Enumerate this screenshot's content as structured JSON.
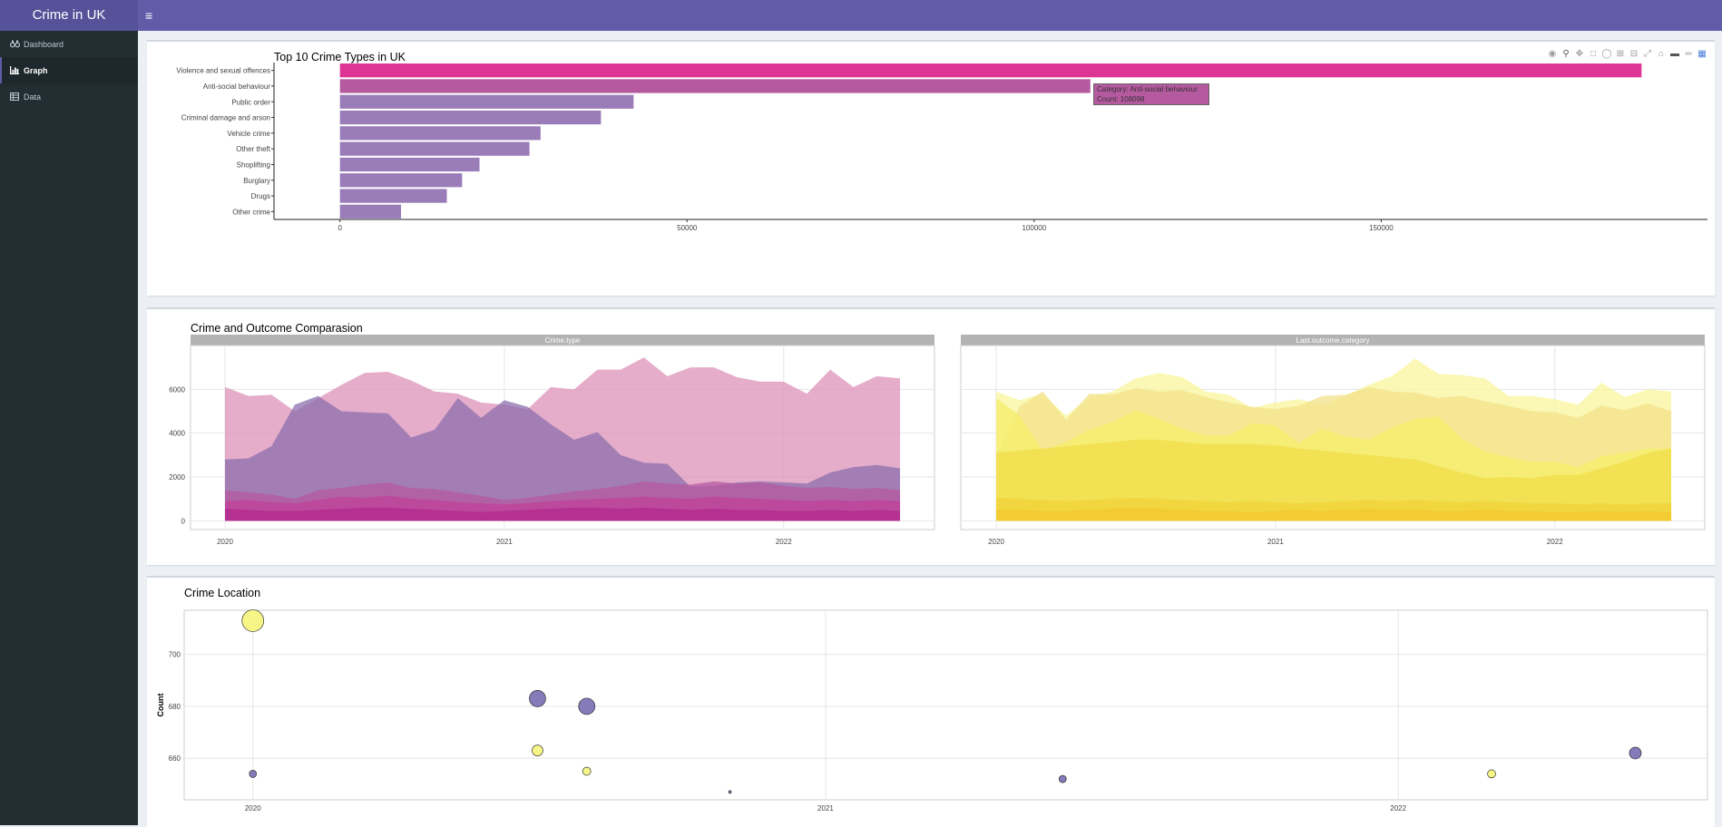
{
  "app": {
    "title": "Crime in UK"
  },
  "sidebar": {
    "items": [
      {
        "label": "Dashboard",
        "icon": "binoculars-icon"
      },
      {
        "label": "Graph",
        "icon": "bar-chart-icon",
        "active": true
      },
      {
        "label": "Data",
        "icon": "table-icon"
      }
    ]
  },
  "panels": {
    "top10_title": "Top 10 Crime Types in UK",
    "comparison_title": "Crime and Outcome Comparasion",
    "location_title": "Crime Location",
    "facet_left": "Crime.type",
    "facet_right": "Last.outcome.category"
  },
  "tooltip": {
    "line1": "Category: Anti-social behaviour",
    "line2": "Count: 108098"
  },
  "colors": {
    "sidebar": "#222d32",
    "topbar": "#605ca8",
    "logo": "#555299",
    "top_bar": "#de3493",
    "bar": "#9a7cb9"
  },
  "chart_data": [
    {
      "type": "bar",
      "orientation": "horizontal",
      "title": "Top 10 Crime Types in UK",
      "categories": [
        "Violence and sexual offences",
        "Anti-social behaviour",
        "Public order",
        "Criminal damage and arson",
        "Vehicle crime",
        "Other theft",
        "Shoplifting",
        "Burglary",
        "Drugs",
        "Other crime"
      ],
      "values": [
        187500,
        108098,
        42300,
        37600,
        28900,
        27300,
        20100,
        17600,
        15400,
        8800
      ],
      "xticks": [
        0,
        50000,
        100000,
        150000
      ],
      "xlim": [
        -9500,
        197000
      ]
    },
    {
      "type": "area",
      "title": "Crime and Outcome Comparasion",
      "facets": [
        "Crime.type",
        "Last.outcome.category"
      ],
      "x_ticks": [
        "2020",
        "2021",
        "2022"
      ],
      "y_ticks": [
        0,
        2000,
        4000,
        6000
      ],
      "ylim": [
        -400,
        8000
      ],
      "months": 30,
      "left_series": [
        {
          "color": "#dc91b8",
          "values": [
            6100,
            5700,
            5750,
            5000,
            5600,
            6200,
            6750,
            6800,
            6400,
            5900,
            5800,
            5400,
            5300,
            5100,
            6100,
            6000,
            6900,
            6900,
            7450,
            6600,
            7000,
            7000,
            6550,
            6350,
            6350,
            5800,
            6900,
            6100,
            6600,
            6500
          ]
        },
        {
          "color": "#8c6fae",
          "values": [
            2800,
            2850,
            3400,
            5300,
            5700,
            5000,
            4950,
            4900,
            3800,
            4150,
            5600,
            4700,
            5500,
            5200,
            4400,
            3700,
            4050,
            3000,
            2650,
            2600,
            1550,
            1600,
            1750,
            1800,
            1750,
            1700,
            2200,
            2450,
            2550,
            2400
          ]
        },
        {
          "color": "#b65aa0",
          "values": [
            1400,
            1300,
            1200,
            1000,
            1400,
            1500,
            1650,
            1750,
            1500,
            1450,
            1300,
            1150,
            950,
            1050,
            1200,
            1350,
            1450,
            1600,
            1800,
            1700,
            1650,
            1800,
            1700,
            1750,
            1600,
            1500,
            1550,
            1450,
            1500,
            1400
          ]
        },
        {
          "color": "#c0419a",
          "values": [
            900,
            950,
            850,
            800,
            950,
            1100,
            1050,
            1150,
            1000,
            950,
            850,
            800,
            750,
            800,
            900,
            950,
            1000,
            1050,
            1100,
            1050,
            1000,
            1100,
            1050,
            1000,
            950,
            900,
            950,
            900,
            950,
            900
          ]
        },
        {
          "color": "#b3298e",
          "values": [
            550,
            500,
            450,
            450,
            500,
            550,
            600,
            600,
            550,
            500,
            450,
            400,
            450,
            500,
            550,
            600,
            600,
            550,
            600,
            550,
            500,
            550,
            500,
            500,
            450,
            450,
            500,
            450,
            500,
            450
          ]
        }
      ],
      "right_series": [
        {
          "color": "#f8f69b",
          "values": [
            5900,
            5500,
            5800,
            4800,
            5650,
            5900,
            6500,
            6750,
            6550,
            5900,
            5750,
            5150,
            5400,
            5550,
            5300,
            5700,
            6200,
            6600,
            7400,
            6700,
            6650,
            6500,
            5700,
            5700,
            5550,
            5300,
            6300,
            5650,
            6000,
            5900
          ]
        },
        {
          "color": "#f3e18a",
          "values": [
            3000,
            5200,
            5900,
            4600,
            5800,
            5750,
            6050,
            5900,
            5950,
            5650,
            5400,
            5200,
            5100,
            5250,
            5700,
            5750,
            6100,
            5900,
            5850,
            5600,
            5700,
            5450,
            5250,
            5000,
            4950,
            4700,
            5250,
            5050,
            5350,
            5000
          ]
        },
        {
          "color": "#f5ef6a",
          "values": [
            5600,
            4800,
            3200,
            3600,
            4150,
            4500,
            5050,
            4650,
            4200,
            3900,
            3900,
            4450,
            4350,
            3550,
            4200,
            3850,
            3700,
            4250,
            4650,
            4750,
            3750,
            3150,
            2900,
            2700,
            2700,
            2450,
            2950,
            3100,
            3300,
            3300
          ]
        },
        {
          "color": "#f0de48",
          "values": [
            3100,
            3200,
            3300,
            3400,
            3500,
            3600,
            3700,
            3700,
            3600,
            3500,
            3500,
            3500,
            3450,
            3300,
            3200,
            3100,
            3000,
            2900,
            2800,
            2500,
            2200,
            1950,
            2000,
            1950,
            2100,
            2100,
            2400,
            2700,
            3100,
            3300
          ]
        },
        {
          "color": "#f0d138",
          "values": [
            1050,
            1000,
            950,
            900,
            950,
            1000,
            1050,
            1000,
            950,
            900,
            850,
            900,
            850,
            800,
            850,
            900,
            950,
            900,
            950,
            900,
            850,
            900,
            850,
            800,
            800,
            750,
            800,
            750,
            800,
            800
          ]
        },
        {
          "color": "#f1c82f",
          "values": [
            500,
            500,
            450,
            450,
            500,
            550,
            600,
            550,
            500,
            450,
            450,
            400,
            450,
            500,
            450,
            500,
            550,
            500,
            500,
            450,
            450,
            500,
            450,
            450,
            400,
            400,
            450,
            400,
            450,
            400
          ]
        }
      ]
    },
    {
      "type": "scatter",
      "title": "Crime Location",
      "ylabel": "Count",
      "x_ticks": [
        2020,
        2021,
        2022
      ],
      "y_ticks": [
        660,
        680,
        700
      ],
      "ylim": [
        644,
        717
      ],
      "xlim": [
        2019.88,
        2022.54
      ],
      "points": [
        {
          "x": 2020.0,
          "y": 713,
          "size": 12,
          "color": "#f5f582"
        },
        {
          "x": 2020.0,
          "y": 654,
          "size": 4,
          "color": "#7e74b6"
        },
        {
          "x": 2020.497,
          "y": 683,
          "size": 9,
          "color": "#7e74b6"
        },
        {
          "x": 2020.583,
          "y": 680,
          "size": 9,
          "color": "#7e74b6"
        },
        {
          "x": 2020.497,
          "y": 663,
          "size": 6,
          "color": "#f5f582"
        },
        {
          "x": 2020.583,
          "y": 655,
          "size": 4.5,
          "color": "#f5f582"
        },
        {
          "x": 2020.833,
          "y": 647,
          "size": 1.5,
          "color": "#7e74b6"
        },
        {
          "x": 2021.414,
          "y": 652,
          "size": 4,
          "color": "#7e74b6"
        },
        {
          "x": 2022.163,
          "y": 654,
          "size": 4.5,
          "color": "#f5f582"
        },
        {
          "x": 2022.414,
          "y": 662,
          "size": 6.5,
          "color": "#7e74b6"
        }
      ]
    }
  ]
}
